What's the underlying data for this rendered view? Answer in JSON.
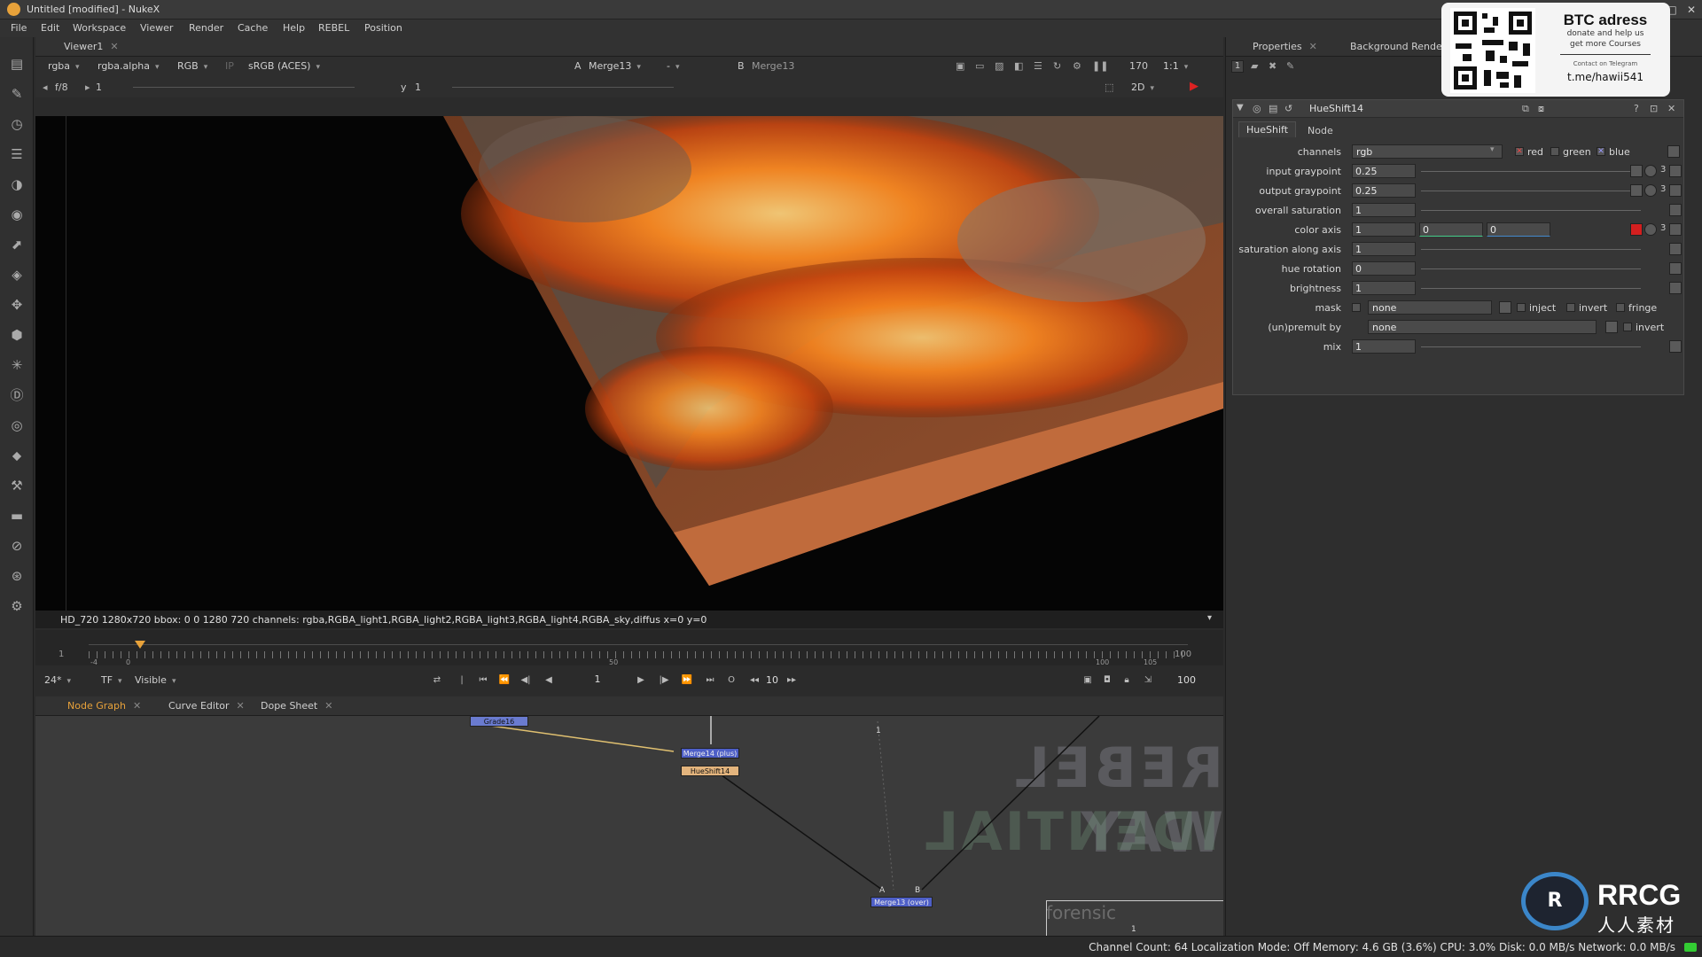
{
  "window": {
    "title": "Untitled [modified] - NukeX"
  },
  "menu": [
    "File",
    "Edit",
    "Workspace",
    "Viewer",
    "Render",
    "Cache",
    "Help",
    "REBEL",
    "Position"
  ],
  "viewer": {
    "tab_label": "Viewer1",
    "channels": "rgba",
    "alpha": "rgba.alpha",
    "display": "RGB",
    "ip": "IP",
    "colorspace": "sRGB (ACES)",
    "a_label": "A",
    "a_input": "Merge13",
    "dash": "-",
    "b_label": "B",
    "b_input": "Merge13",
    "zoom_pct": "170",
    "zoom_ratio": "1:1",
    "fstop": "f/8",
    "gain": "1",
    "gamma_label": "y",
    "gamma": "1",
    "view_mode": "2D",
    "info": "HD_720 1280x720  bbox: 0 0 1280 720 channels: rgba,RGBA_light1,RGBA_light2,RGBA_light3,RGBA_light4,RGBA_sky,diffus  x=0 y=0"
  },
  "timeline": {
    "start": "1",
    "end": "100",
    "ticks": [
      "-4",
      "0",
      "50",
      "100",
      "105"
    ],
    "fps": "24*",
    "tf": "TF",
    "visible": "Visible",
    "current_frame": "1",
    "step": "10",
    "end_frame": "100"
  },
  "nodegraph": {
    "tabs": [
      "Node Graph",
      "Curve Editor",
      "Dope Sheet"
    ],
    "nodes": {
      "top_left": "Grade16",
      "merge_alpha": "Merge14 (plus)",
      "hueshift": "HueShift14",
      "merge13": "Merge13 (over)"
    },
    "input_a": "A",
    "input_b": "B",
    "dot_label": "1",
    "frame_label": "1"
  },
  "properties": {
    "tabs": [
      "Properties",
      "Background Renders"
    ],
    "count": "1",
    "node_name": "HueShift14",
    "subtabs": [
      "HueShift",
      "Node"
    ],
    "channels": {
      "label": "channels",
      "value": "rgb",
      "red": "red",
      "green": "green",
      "blue": "blue"
    },
    "rows": [
      {
        "label": "input graypoint",
        "value": "0.25"
      },
      {
        "label": "output graypoint",
        "value": "0.25"
      },
      {
        "label": "overall saturation",
        "value": "1"
      },
      {
        "label": "color axis",
        "value": "1",
        "value2": "0",
        "value3": "0"
      },
      {
        "label": "saturation along axis",
        "value": "1"
      },
      {
        "label": "hue rotation",
        "value": "0"
      },
      {
        "label": "brightness",
        "value": "1"
      }
    ],
    "mask": {
      "label": "mask",
      "value": "none",
      "inject": "inject",
      "invert": "invert",
      "fringe": "fringe"
    },
    "unpremult": {
      "label": "(un)premult by",
      "value": "none",
      "invert": "invert"
    },
    "mix": {
      "label": "mix",
      "value": "1"
    },
    "button_count": "3"
  },
  "overlay": {
    "title": "BTC adress",
    "line1": "donate and help us",
    "line2": "get more Courses",
    "contact": "Contact on Telegram",
    "handle": "t.me/hawii541",
    "brand": "RRCG",
    "brand_cn": "人人素材"
  },
  "statusbar": {
    "text": "Channel Count: 64  Localization Mode: Off  Memory: 4.6 GB (3.6%)  CPU: 3.0%  Disk: 0.0 MB/s  Network: 0.0 MB/s"
  },
  "background_text": {
    "line1": "REBEL WAY",
    "line2": "CONFIDENTIAL",
    "line3": "forensic"
  },
  "colors": {
    "accent": "#e8a23a",
    "merge_node": "#4e5fc7",
    "hueshift_node": "#e3b47d",
    "color_axis_swatch": "#d31f1f"
  }
}
